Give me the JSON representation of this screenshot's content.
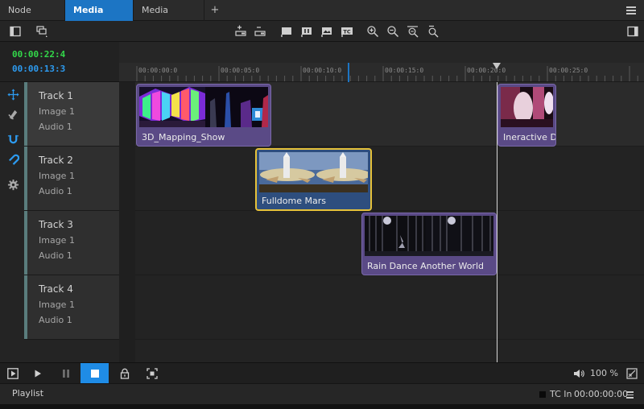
{
  "tabs": [
    {
      "label": "Node Graph"
    },
    {
      "label": "Media Player"
    },
    {
      "label": "Media Library"
    }
  ],
  "tab_add_label": "+",
  "timecodes": {
    "current": "00:00:22:4",
    "duration": "00:00:13:3"
  },
  "tracks": [
    {
      "name": "Track 1",
      "image": "Image 1",
      "audio": "Audio 1"
    },
    {
      "name": "Track 2",
      "image": "Image 1",
      "audio": "Audio 1"
    },
    {
      "name": "Track 3",
      "image": "Image 1",
      "audio": "Audio 1"
    },
    {
      "name": "Track 4",
      "image": "Image 1",
      "audio": "Audio 1"
    }
  ],
  "ruler": {
    "labels": [
      "00:00:00:0",
      "00:00:05:0",
      "00:00:10:0",
      "00:00:15:0",
      "00:00:20:0",
      "00:00:25:0"
    ]
  },
  "clips": [
    {
      "label": "3D_Mapping_Show",
      "track": 1,
      "selected": false
    },
    {
      "label": "Ineractive Dar",
      "track": 1,
      "selected": false
    },
    {
      "label": "Fulldome Mars",
      "track": 2,
      "selected": true
    },
    {
      "label": "Rain Dance Another World",
      "track": 3,
      "selected": false
    }
  ],
  "transport": {
    "volume": "100 %"
  },
  "status": {
    "playlist": "Playlist",
    "tc_in_label": "TC In",
    "tc_in_value": "00:00:00:00"
  },
  "colors": {
    "accent": "#1c75c4",
    "timecode_green": "#33d84a",
    "timecode_blue": "#2d9bf0",
    "clip": "#5a4a86",
    "clip_selected_border": "#e6c23a"
  },
  "icons": {
    "toolbar": [
      "sidebar-toggle-icon",
      "layers-icon",
      "add-track-icon",
      "remove-track-icon",
      "flag-icon",
      "marker-icon",
      "image-marker-icon",
      "tc-icon",
      "zoom-in-icon",
      "zoom-out-icon",
      "zoom-fit-icon",
      "zoom-reset-icon",
      "right-panel-icon"
    ],
    "tools": [
      "move-icon",
      "razor-icon",
      "snap-magnet-icon",
      "magnet-icon",
      "settings-icon"
    ],
    "transport": [
      "play-framed-icon",
      "play-icon",
      "pause-icon",
      "stop-icon",
      "lock-icon",
      "fullscreen-icon",
      "speaker-icon",
      "output-icon"
    ]
  }
}
